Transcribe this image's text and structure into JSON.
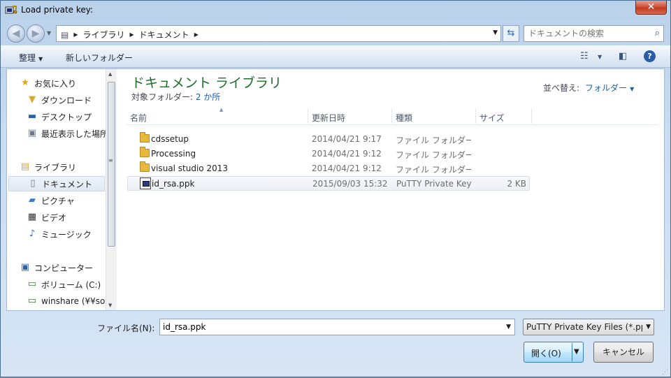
{
  "window": {
    "title": "Load private key:",
    "close_glyph": "✕"
  },
  "nav": {
    "back_glyph": "◀",
    "forward_glyph": "▶",
    "breadcrumbs": [
      "ライブラリ",
      "ドキュメント"
    ],
    "search_placeholder": "ドキュメントの検索"
  },
  "toolbar": {
    "organize": "整理",
    "new_folder": "新しいフォルダー"
  },
  "sidebar": {
    "favorites": {
      "label": "お気に入り",
      "items": [
        "ダウンロード",
        "デスクトップ",
        "最近表示した場所"
      ]
    },
    "libraries": {
      "label": "ライブラリ",
      "items": [
        "ドキュメント",
        "ピクチャ",
        "ビデオ",
        "ミュージック"
      ]
    },
    "computer": {
      "label": "コンピューター",
      "items": [
        "ボリューム (C:)",
        "winshare (¥¥so"
      ]
    }
  },
  "library": {
    "title": "ドキュメント ライブラリ",
    "target_label": "対象フォルダー: ",
    "target_count": "2 か所",
    "sort_label": "並べ替え:",
    "sort_value": "フォルダー"
  },
  "columns": {
    "name": "名前",
    "date": "更新日時",
    "type": "種類",
    "size": "サイズ"
  },
  "files": [
    {
      "name": "cdssetup",
      "date": "2014/04/21 9:17",
      "type": "ファイル フォルダー",
      "size": "",
      "kind": "folder"
    },
    {
      "name": "Processing",
      "date": "2014/04/21 9:12",
      "type": "ファイル フォルダー",
      "size": "",
      "kind": "folder"
    },
    {
      "name": "visual studio 2013",
      "date": "2014/04/21 9:12",
      "type": "ファイル フォルダー",
      "size": "",
      "kind": "folder"
    },
    {
      "name": "id_rsa.ppk",
      "date": "2015/09/03 15:32",
      "type": "PuTTY Private Key File",
      "size": "2 KB",
      "kind": "ppk"
    }
  ],
  "footer": {
    "filename_label": "ファイル名(N):",
    "filename_value": "id_rsa.ppk",
    "filter_value": "PuTTY Private Key Files (*.ppk)",
    "open_label": "開く(O)",
    "cancel_label": "キャンセル"
  }
}
